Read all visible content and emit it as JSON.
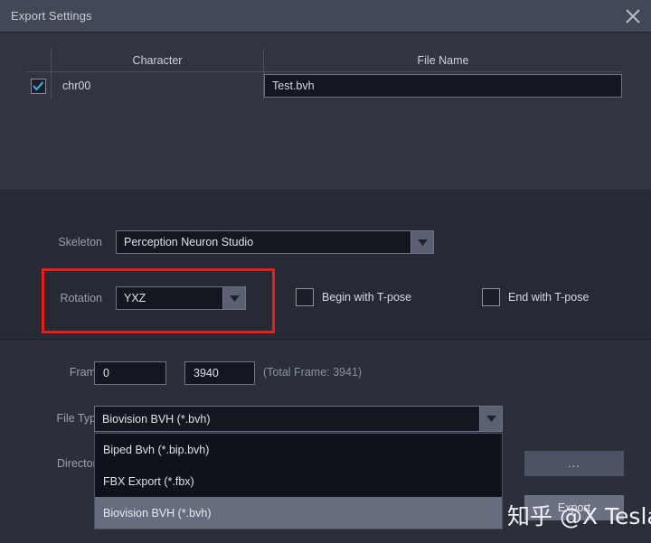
{
  "window": {
    "title": "Export Settings",
    "close_icon": "close-x-icon"
  },
  "character_table": {
    "columns": [
      "",
      "Character",
      "File Name"
    ],
    "rows": [
      {
        "checked": true,
        "character": "chr00",
        "file_name": "Test.bvh"
      }
    ]
  },
  "skeleton_section": {
    "skeleton_label": "Skeleton",
    "skeleton_value": "Perception Neuron Studio",
    "rotation_label": "Rotation",
    "rotation_value": "YXZ",
    "begin_tpose_label": "Begin with T-pose",
    "begin_tpose_checked": false,
    "end_tpose_label": "End with T-pose",
    "end_tpose_checked": false,
    "highlight_color": "#ef1c1c"
  },
  "output_section": {
    "frame_label": "Frame",
    "frame_start": "0",
    "frame_end": "3940",
    "total_frame_text": "(Total Frame: 3941)",
    "file_type_label": "File Type",
    "file_type_value": "Biovision BVH (*.bvh)",
    "file_type_options": [
      "Biped Bvh (*.bip.bvh)",
      "FBX Export (*.fbx)",
      "Biovision BVH (*.bvh)"
    ],
    "file_type_selected_index": 2,
    "directory_label": "Directory",
    "browse_button_label": "...",
    "export_button_label": "Export"
  },
  "watermark": {
    "text": "知乎 @X Tesla"
  }
}
